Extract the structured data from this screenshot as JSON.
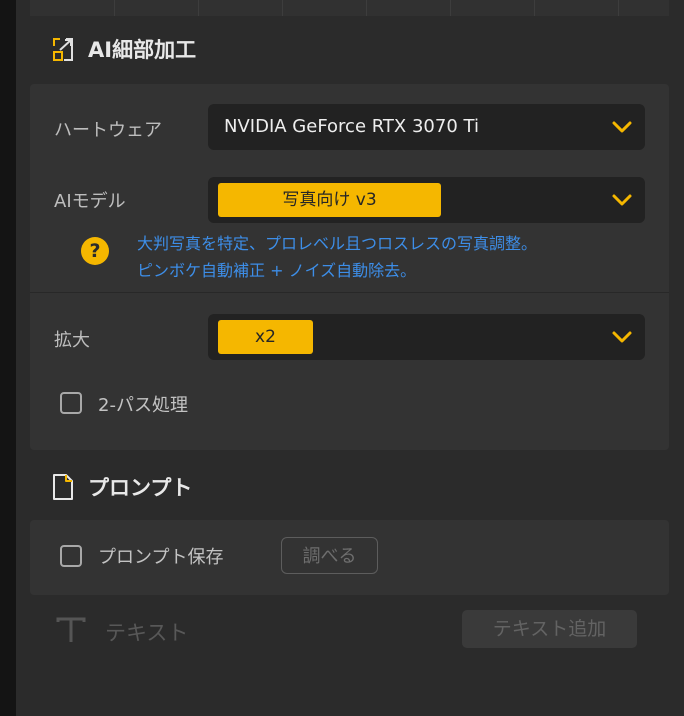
{
  "ai_detail": {
    "title": "AI細部加工",
    "hardware": {
      "label": "ハートウェア",
      "value": "NVIDIA GeForce RTX 3070 Ti"
    },
    "model": {
      "label": "AIモデル",
      "value": "写真向け v3",
      "hint": [
        "大判写真を特定、プロレベル且つロスレスの写真調整。",
        "ピンボケ自動補正 + ノイズ自動除去。"
      ]
    },
    "scale": {
      "label": "拡大",
      "value": "x2"
    },
    "two_pass": {
      "label": "2-パス処理",
      "checked": false
    }
  },
  "prompt": {
    "title": "プロンプト",
    "save_label": "プロンプト保存",
    "browse_label": "調べる"
  },
  "text": {
    "label": "テキスト",
    "add_button": "テキスト追加"
  },
  "colors": {
    "accent": "#f5b700",
    "hint_text": "#3d8ee8",
    "panel": "#333333",
    "background": "#2b2b2b"
  }
}
